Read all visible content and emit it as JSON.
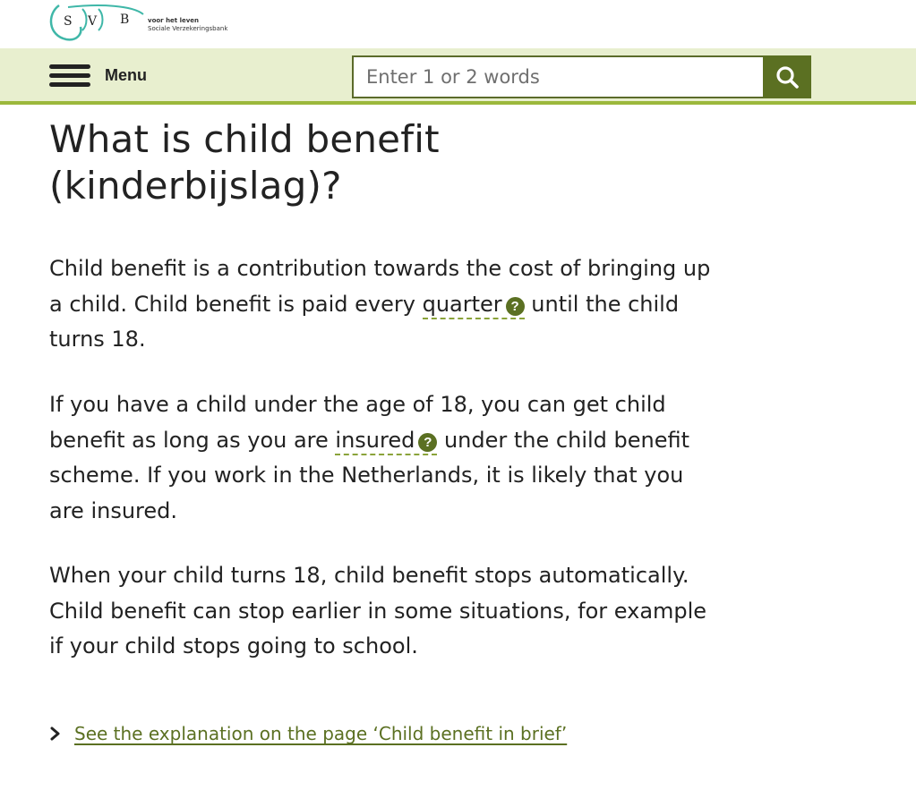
{
  "brand": {
    "logo_letters": [
      "S",
      "V",
      "B"
    ],
    "tagline_line1": "voor het leven",
    "tagline_line2": "Sociale Verzekeringsbank",
    "accent_color": "#5b7022",
    "nav_background": "#e8efcf",
    "nav_border_color": "#9cb83c"
  },
  "nav": {
    "menu_icon": "hamburger-icon",
    "menu_label": "Menu",
    "search_placeholder": "Enter 1 or 2 words",
    "search_value": "",
    "search_icon": "search-icon"
  },
  "main": {
    "title": "What is child benefit (kinderbijslag)?",
    "p1": {
      "before": "Child benefit is a contribution towards the cost of bringing up a child. Child benefit is paid every ",
      "term": "quarter",
      "after": " until the child turns 18."
    },
    "p2": {
      "before": "If you have a child under the age of 18, you can get child benefit as long as you are ",
      "term": "insured",
      "after": " under the child benefit scheme. If you work in the Netherlands, it is likely that you are insured."
    },
    "p3": "When your child turns 18, child benefit stops automatically. Child benefit can stop earlier in some situations, for example if your child stops going to school.",
    "help_glyph": "?",
    "more_link": "See the explanation on the page ‘Child benefit in brief’"
  }
}
